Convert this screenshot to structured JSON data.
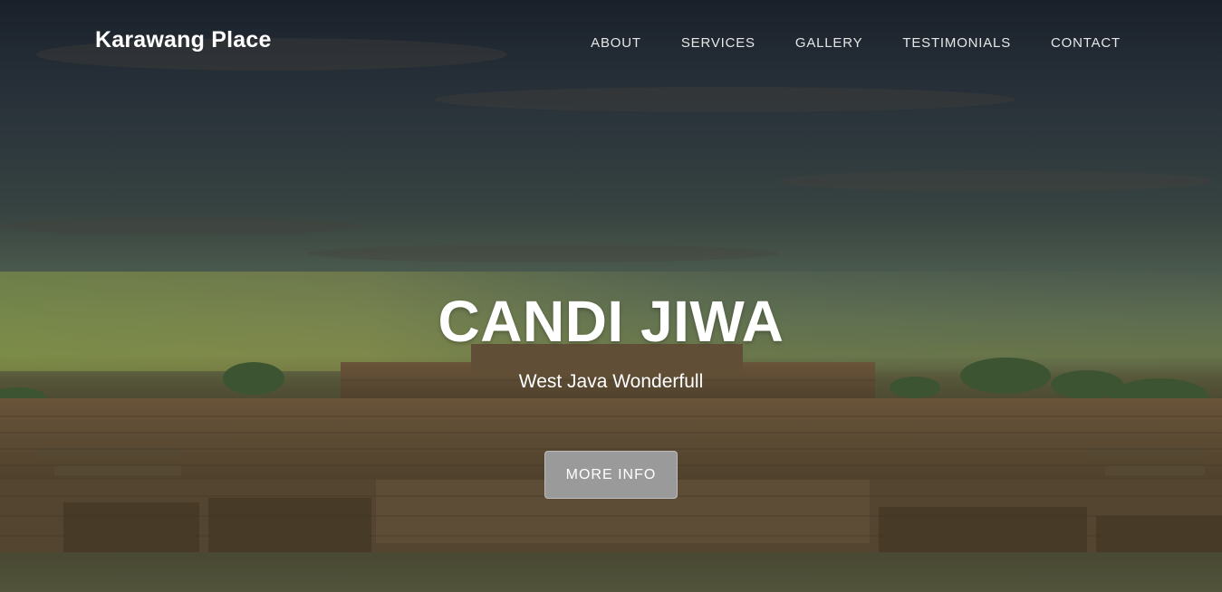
{
  "navbar": {
    "brand": "Karawang Place",
    "links": [
      "ABOUT",
      "SERVICES",
      "GALLERY",
      "TESTIMONIALS",
      "CONTACT"
    ]
  },
  "hero": {
    "title": "CANDI JIWA",
    "subtitle": "West Java Wonderfull",
    "button_label": "MORE INFO",
    "background_image": "temple-ruins-sunset"
  },
  "colors": {
    "text": "#ffffff",
    "nav_text": "#e6e6e6",
    "button_bg": "#9a9a9a"
  }
}
